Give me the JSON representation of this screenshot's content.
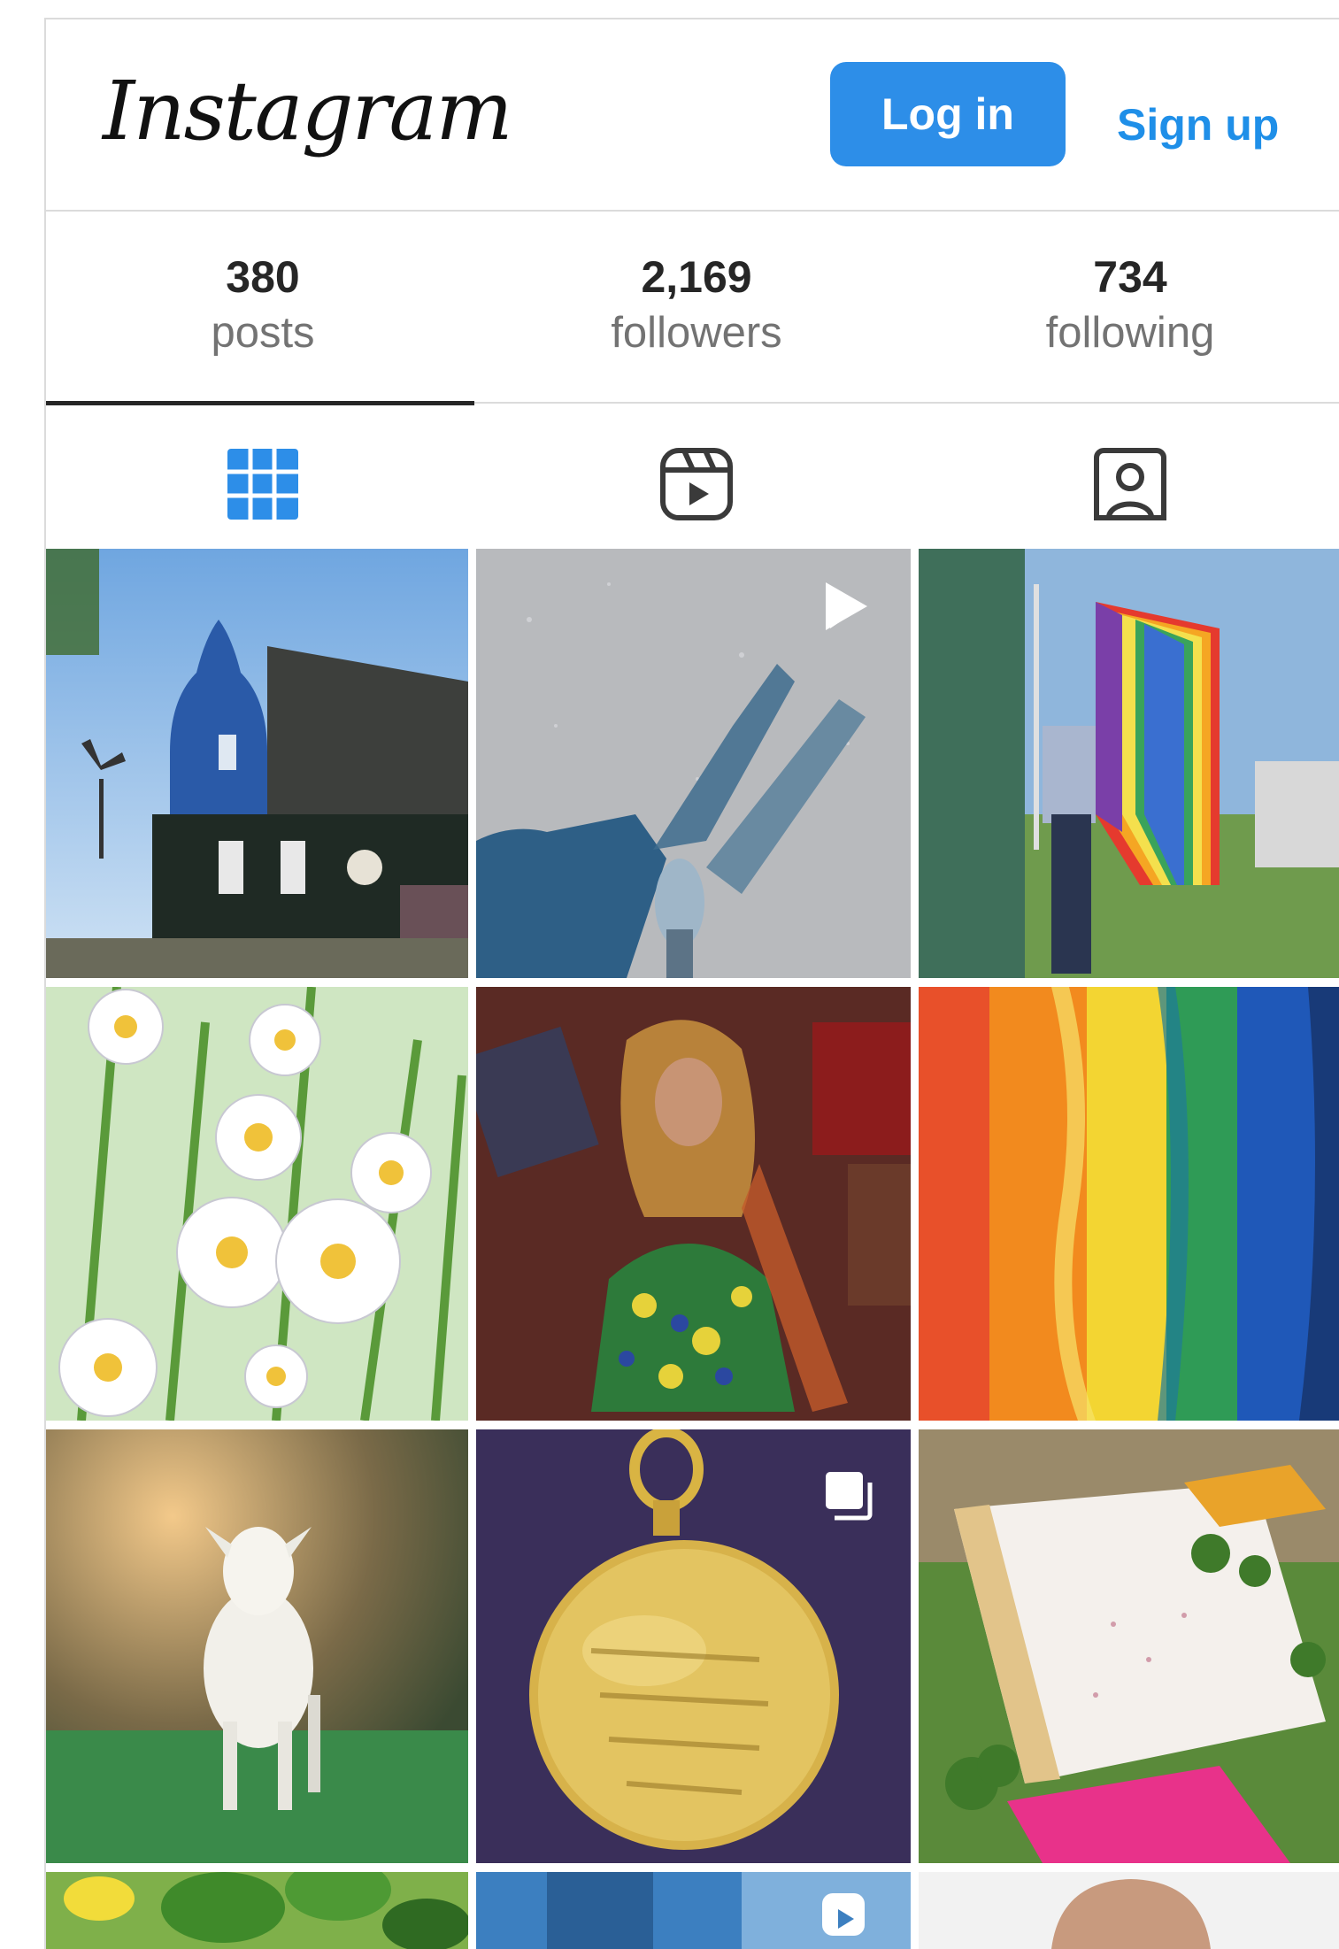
{
  "header": {
    "logo_text": "Instagram",
    "login_label": "Log in",
    "signup_label": "Sign up"
  },
  "stats": [
    {
      "value": "380",
      "label": "posts"
    },
    {
      "value": "2,169",
      "label": "followers"
    },
    {
      "value": "734",
      "label": "following"
    }
  ],
  "tabs": [
    {
      "name": "posts-grid",
      "icon": "grid-icon",
      "active": true
    },
    {
      "name": "reels",
      "icon": "reels-icon",
      "active": false
    },
    {
      "name": "tagged",
      "icon": "tagged-user-icon",
      "active": false
    }
  ],
  "colors": {
    "accent": "#2d8ee8",
    "link": "#1f8fe8",
    "muted": "#737373",
    "border": "#dbdbdb"
  },
  "posts": [
    {
      "subject": "blue gabled house with windmill",
      "badge": "none"
    },
    {
      "subject": "shadow of legs on asphalt",
      "badge": "video-icon"
    },
    {
      "subject": "person hanging rainbow flag",
      "badge": "none"
    },
    {
      "subject": "painted daisies",
      "badge": "none"
    },
    {
      "subject": "performer in colorful dress",
      "badge": "none"
    },
    {
      "subject": "rainbow paint strokes",
      "badge": "none"
    },
    {
      "subject": "white goat on grass",
      "badge": "none"
    },
    {
      "subject": "engraved gold medal",
      "badge": "carousel-icon"
    },
    {
      "subject": "painted planks with plants",
      "badge": "none"
    },
    {
      "subject": "yellow flowers and leaves",
      "badge": "none"
    },
    {
      "subject": "blue sky scene",
      "badge": "reels-icon"
    },
    {
      "subject": "portrait of bald man",
      "badge": "none"
    }
  ]
}
